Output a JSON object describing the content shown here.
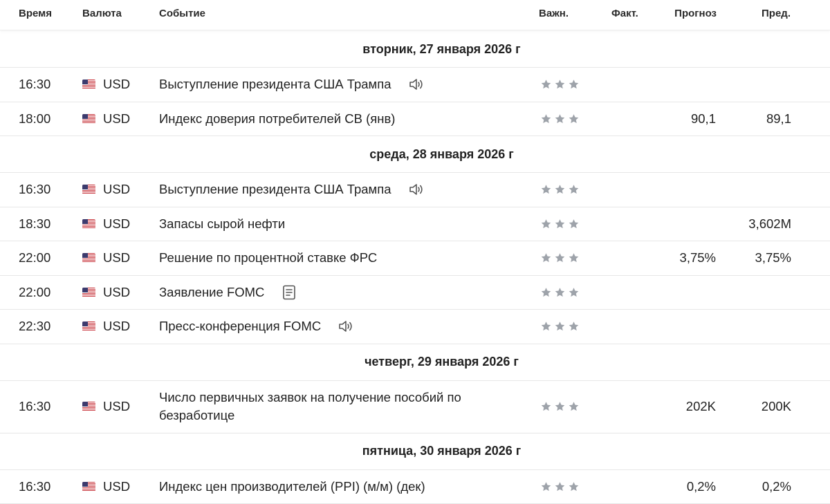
{
  "columns": {
    "time": "Время",
    "currency": "Валюта",
    "event": "Событие",
    "importance": "Важн.",
    "actual": "Факт.",
    "forecast": "Прогноз",
    "previous": "Пред."
  },
  "colors": {
    "star_inactive": "#9ea3aa",
    "divider": "#e7e7e7",
    "text": "#222222"
  },
  "days": [
    {
      "label": "вторник, 27 января 2026 г",
      "events": [
        {
          "time": "16:30",
          "currency": "USD",
          "flag": "us-flag-icon",
          "event": "Выступление президента США Трампа",
          "icon": "speaker-icon",
          "importance": 3,
          "actual": "",
          "forecast": "",
          "previous": ""
        },
        {
          "time": "18:00",
          "currency": "USD",
          "flag": "us-flag-icon",
          "event": "Индекс доверия потребителей CB  (янв)",
          "icon": "",
          "importance": 3,
          "actual": "",
          "forecast": "90,1",
          "previous": "89,1"
        }
      ]
    },
    {
      "label": "среда, 28 января 2026 г",
      "events": [
        {
          "time": "16:30",
          "currency": "USD",
          "flag": "us-flag-icon",
          "event": "Выступление президента США Трампа",
          "icon": "speaker-icon",
          "importance": 3,
          "actual": "",
          "forecast": "",
          "previous": ""
        },
        {
          "time": "18:30",
          "currency": "USD",
          "flag": "us-flag-icon",
          "event": "Запасы сырой нефти",
          "icon": "",
          "importance": 3,
          "actual": "",
          "forecast": "",
          "previous": "3,602M"
        },
        {
          "time": "22:00",
          "currency": "USD",
          "flag": "us-flag-icon",
          "event": "Решение по процентной ставке ФРС",
          "icon": "",
          "importance": 3,
          "actual": "",
          "forecast": "3,75%",
          "previous": "3,75%"
        },
        {
          "time": "22:00",
          "currency": "USD",
          "flag": "us-flag-icon",
          "event": "Заявление FOMC",
          "icon": "document-icon",
          "importance": 3,
          "actual": "",
          "forecast": "",
          "previous": ""
        },
        {
          "time": "22:30",
          "currency": "USD",
          "flag": "us-flag-icon",
          "event": "Пресс-конференция FOMC",
          "icon": "speaker-icon",
          "importance": 3,
          "actual": "",
          "forecast": "",
          "previous": ""
        }
      ]
    },
    {
      "label": "четверг, 29 января 2026 г",
      "events": [
        {
          "time": "16:30",
          "currency": "USD",
          "flag": "us-flag-icon",
          "event": "Число первичных заявок на получение пособий по безработице",
          "icon": "",
          "importance": 3,
          "actual": "",
          "forecast": "202K",
          "previous": "200K",
          "wrap": true
        }
      ]
    },
    {
      "label": "пятница, 30 января 2026 г",
      "events": [
        {
          "time": "16:30",
          "currency": "USD",
          "flag": "us-flag-icon",
          "event": "Индекс цен производителей (PPI) (м/м) (дек)",
          "icon": "",
          "importance": 3,
          "actual": "",
          "forecast": "0,2%",
          "previous": "0,2%"
        }
      ]
    }
  ]
}
